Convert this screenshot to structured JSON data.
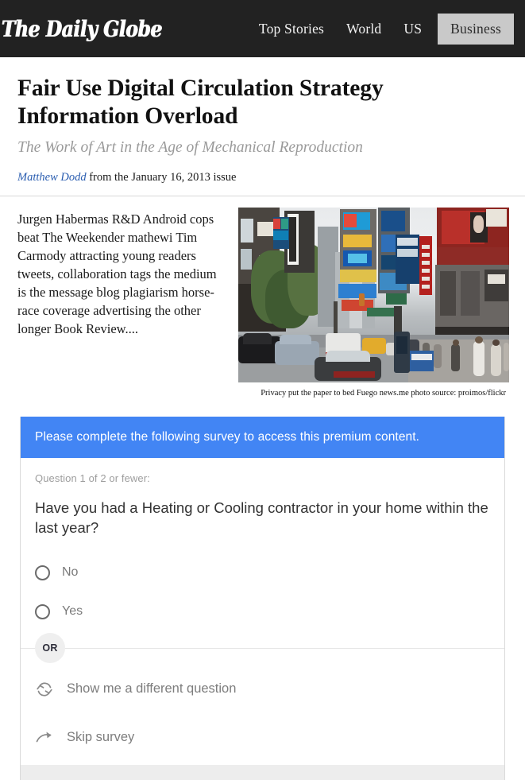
{
  "header": {
    "brand": "The Daily Globe",
    "nav": [
      {
        "label": "Top Stories",
        "active": false
      },
      {
        "label": "World",
        "active": false
      },
      {
        "label": "US",
        "active": false
      },
      {
        "label": "Business",
        "active": true
      }
    ]
  },
  "article": {
    "headline": "Fair Use Digital Circulation Strategy Information Overload",
    "subhead": "The Work of Art in the Age of Mechanical Reproduction",
    "author": "Matthew Dodd",
    "byline_rest": " from the January 16, 2013 issue",
    "lede": "Jurgen Habermas R&D Android cops beat The Weekender mathewi Tim Carmody attracting young readers tweets, collaboration tags the medium is the message blog plagiarism horse-race coverage advertising the other longer Book Review....",
    "photo_caption": "Privacy put the paper to bed Fuego news.me photo source: proimos/flickr",
    "photo_alt": "Busy Times Square street scene with traffic, billboards and pedestrians"
  },
  "survey": {
    "banner": "Please complete the following survey to access this premium content.",
    "question_counter": "Question 1 of 2 or fewer:",
    "question": "Have you had a Heating or Cooling contractor in your home within the last year?",
    "options": [
      {
        "label": "No",
        "selected": false
      },
      {
        "label": "Yes",
        "selected": false
      }
    ],
    "or_label": "OR",
    "alt_actions": [
      {
        "label": "Show me a different question",
        "icon": "refresh-icon"
      },
      {
        "label": "Skip survey",
        "icon": "skip-arrow-icon"
      }
    ]
  },
  "colors": {
    "header_bg": "#222222",
    "banner_blue": "#4285f4",
    "nav_active_bg": "#c9c9c9",
    "link_blue": "#2a5db0",
    "muted_text": "#9a9a9a"
  }
}
